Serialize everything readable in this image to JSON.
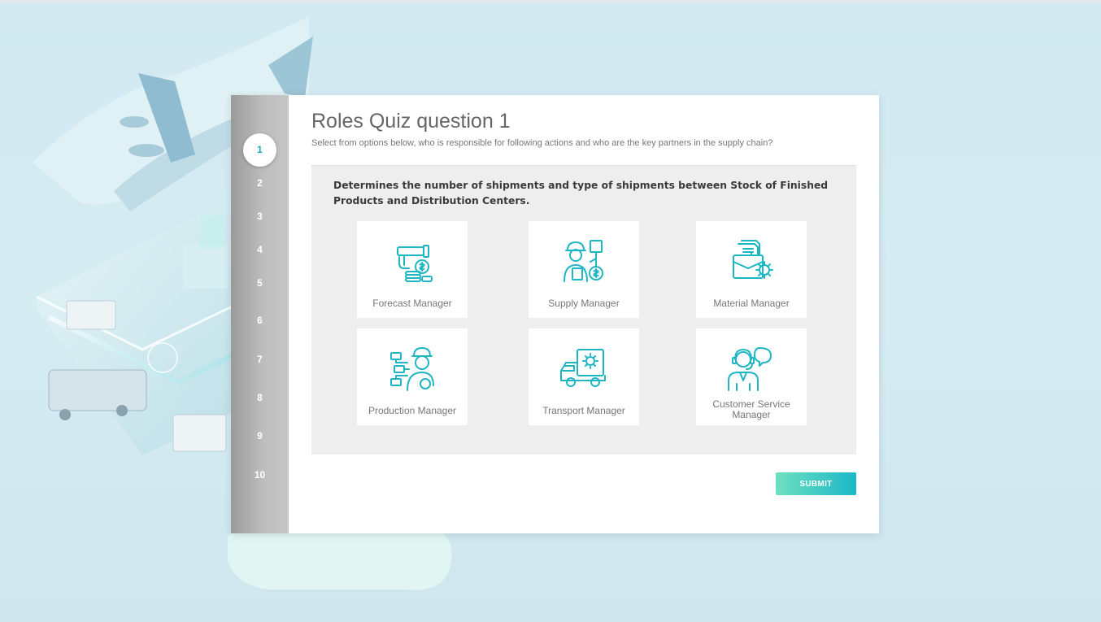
{
  "quiz": {
    "title": "Roles Quiz question 1",
    "subtitle": "Select from options below, who is responsible for following actions and who are the key partners in the supply chain?",
    "question": "Determines the number of shipments and type of shipments between Stock of Finished Products and Distribution Centers.",
    "submit_label": "SUBMIT"
  },
  "steps": [
    "1",
    "2",
    "3",
    "4",
    "5",
    "6",
    "7",
    "8",
    "9",
    "10"
  ],
  "active_step": "1",
  "options": [
    {
      "label": "Forecast Manager",
      "icon": "forecast-manager-icon"
    },
    {
      "label": "Supply Manager",
      "icon": "supply-manager-icon"
    },
    {
      "label": "Material Manager",
      "icon": "material-manager-icon"
    },
    {
      "label": "Production Manager",
      "icon": "production-manager-icon"
    },
    {
      "label": "Transport Manager",
      "icon": "transport-manager-icon"
    },
    {
      "label": "Customer Service Manager",
      "icon": "customer-service-manager-icon"
    }
  ],
  "colors": {
    "accent": "#17a7c2",
    "icon": "#1fb6c4",
    "submit_start": "#6fe0c0",
    "submit_end": "#1ab8c8"
  }
}
